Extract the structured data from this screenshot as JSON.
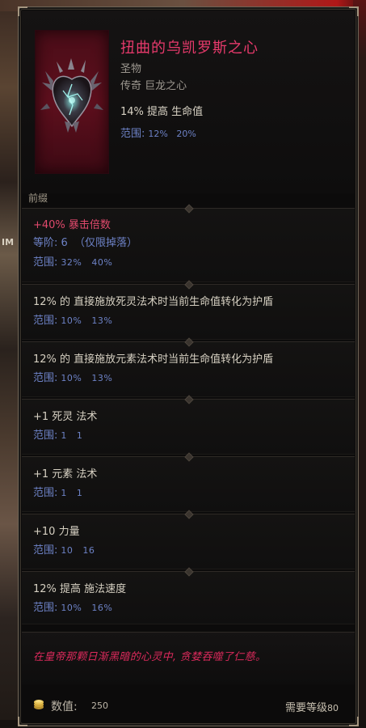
{
  "background": {
    "left_label": "IM"
  },
  "item": {
    "name": "扭曲的乌凯罗斯之心",
    "base_type": "圣物",
    "rarity_line": "传奇 巨龙之心",
    "implicit": {
      "text": "14% 提高 生命值",
      "range_label": "范围:",
      "range_values": "12%   20%"
    }
  },
  "prefix_label": "前缀",
  "mods": [
    {
      "text": "+40% 暴击倍数",
      "tier": "等阶: 6  （仅限掉落）",
      "range_label": "范围:",
      "range_values": "32%   40%"
    },
    {
      "text": "12% 的 直接施放死灵法术时当前生命值转化为护盾",
      "range_label": "范围:",
      "range_values": "10%   13%"
    },
    {
      "text": "12% 的 直接施放元素法术时当前生命值转化为护盾",
      "range_label": "范围:",
      "range_values": "10%   13%"
    },
    {
      "text": "+1 死灵 法术",
      "range_label": "范围:",
      "range_values": "1   1"
    },
    {
      "text": "+1 元素 法术",
      "range_label": "范围:",
      "range_values": "1   1"
    },
    {
      "text": "+10 力量",
      "range_label": "范围:",
      "range_values": "10   16"
    },
    {
      "text": "12% 提高 施法速度",
      "range_label": "范围:",
      "range_values": "10%   16%"
    }
  ],
  "flavor_text": "在皇帝那颗日渐黑暗的心灵中, 贪婪吞噬了仁慈。",
  "footer": {
    "value_label": "数值:",
    "value": "250",
    "required_level_label": "需要等级",
    "required_level": "80"
  },
  "colors": {
    "title": "#e83a6c",
    "range": "#6d82c6",
    "flavor": "#dc2a5c",
    "item_frame": "#5e0f1d"
  }
}
